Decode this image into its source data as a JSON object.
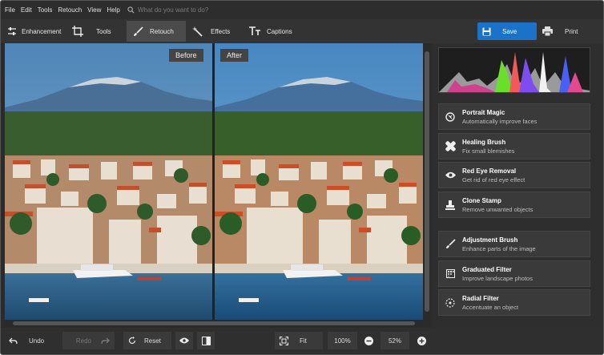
{
  "menu": {
    "items": [
      "File",
      "Edit",
      "Tools",
      "Retouch",
      "View",
      "Help"
    ],
    "search_placeholder": "What do you want to do?"
  },
  "toolbar": {
    "tabs": [
      {
        "label": "Enhancement",
        "icon": "sliders-icon"
      },
      {
        "label": "Tools",
        "icon": "crop-icon"
      },
      {
        "label": "Retouch",
        "icon": "brush-icon",
        "active": true
      },
      {
        "label": "Effects",
        "icon": "magic-wand-icon"
      },
      {
        "label": "Captions",
        "icon": "text-icon"
      }
    ],
    "save_label": "Save",
    "print_label": "Print"
  },
  "canvas": {
    "before_label": "Before",
    "after_label": "After"
  },
  "right_panel": {
    "tools": [
      {
        "title": "Portrait Magic",
        "desc": "Automatically improve faces",
        "icon": "portrait-magic-icon"
      },
      {
        "title": "Healing Brush",
        "desc": "Fix small blemishes",
        "icon": "bandage-icon"
      },
      {
        "title": "Red Eye Removal",
        "desc": "Get rid of red eye effect",
        "icon": "eye-icon"
      },
      {
        "title": "Clone Stamp",
        "desc": "Remove unwanted objects",
        "icon": "stamp-icon"
      },
      {
        "title": "Adjustment Brush",
        "desc": "Enhance parts of the image",
        "icon": "adjustment-brush-icon"
      },
      {
        "title": "Graduated Filter",
        "desc": "Improve landscape photos",
        "icon": "graduated-filter-icon"
      },
      {
        "title": "Radial Filter",
        "desc": "Accentuate an object",
        "icon": "radial-filter-icon"
      }
    ]
  },
  "bottom": {
    "undo_label": "Undo",
    "redo_label": "Redo",
    "reset_label": "Reset",
    "fit_label": "Fit",
    "zoom_100_label": "100%",
    "zoom_value": "52%"
  },
  "colors": {
    "accent": "#1a73c8",
    "panel": "#3a3a3a",
    "background": "#2b2b2b"
  }
}
